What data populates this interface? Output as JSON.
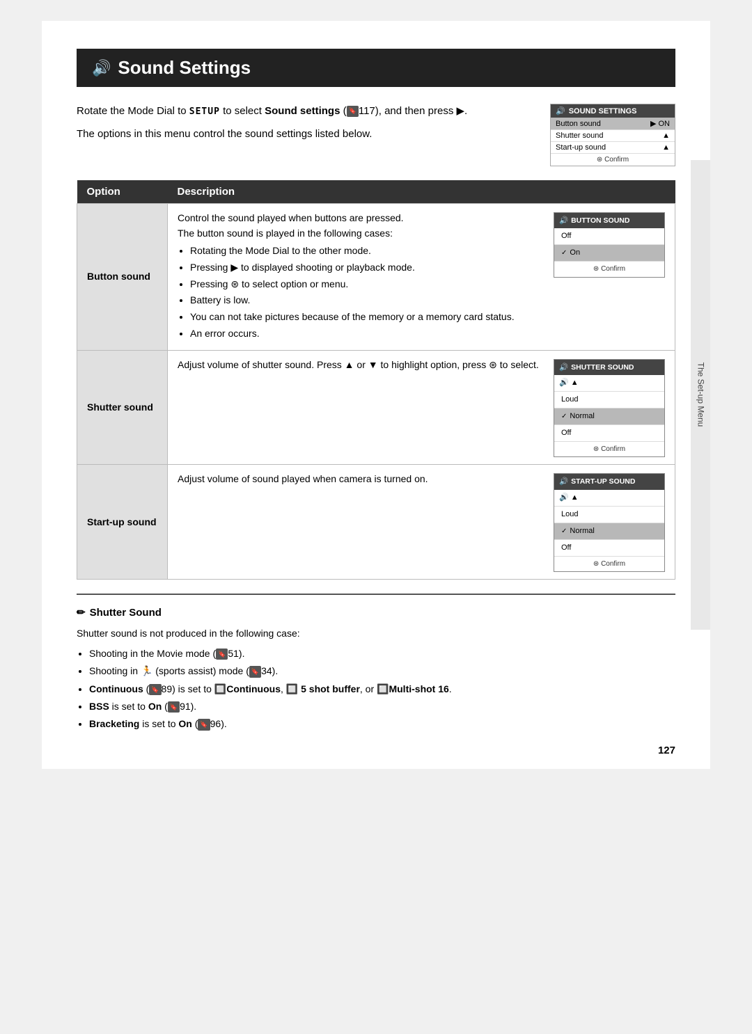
{
  "page": {
    "title": "Sound Settings",
    "speaker_icon": "🔊",
    "page_number": "127",
    "side_label": "The Set-up Menu"
  },
  "intro": {
    "text1": "Rotate the Mode Dial to",
    "code1": "SETUP",
    "text2": "to select",
    "bold1": "Sound set-tings",
    "ref1": "117",
    "text3": ", and then press",
    "arrow": "▶",
    "text4": ".",
    "text5": "The options in this menu control the sound settings listed below."
  },
  "sound_settings_box": {
    "title": "SOUND SETTINGS",
    "rows": [
      {
        "label": "Button sound",
        "value": "▶ ON",
        "selected": true
      },
      {
        "label": "Shutter sound",
        "value": "▲"
      },
      {
        "label": "Start-up sound",
        "value": "▲"
      }
    ],
    "confirm": "⊛ Confirm"
  },
  "table": {
    "col1": "Option",
    "col2": "Description",
    "rows": [
      {
        "option": "Button sound",
        "desc_lines": [
          "Control the sound played when buttons are pressed.",
          "The button sound is played in the following cases:"
        ],
        "bullets": [
          "Rotating the Mode Dial to the other mode.",
          "Pressing ▶ to displayed shooting or playback mode.",
          "Pressing ⊛ to select option or menu.",
          "Battery is low.",
          "You can not take pictures because of the memory or a memory card status.",
          "An error occurs."
        ],
        "mini_screen": {
          "title": "BUTTON SOUND",
          "rows": [
            {
              "label": "Off",
              "checked": false
            },
            {
              "label": "On",
              "checked": true
            }
          ],
          "confirm": "⊛ Confirm"
        }
      },
      {
        "option": "Shutter sound",
        "desc_lines": [
          "Adjust volume of shutter sound. Press ▲ or ▼ to highlight option, press ⊛ to select."
        ],
        "bullets": [],
        "mini_screen": {
          "title": "SHUTTER SOUND",
          "icon": "🔊 ▲",
          "rows": [
            {
              "label": "Loud",
              "checked": false
            },
            {
              "label": "Normal",
              "checked": true
            },
            {
              "label": "Off",
              "checked": false
            }
          ],
          "confirm": "⊛ Confirm"
        }
      },
      {
        "option": "Start-up sound",
        "desc_lines": [
          "Adjust volume of sound played when camera is turned on."
        ],
        "bullets": [],
        "mini_screen": {
          "title": "START-UP SOUND",
          "icon": "🔊 ▲",
          "rows": [
            {
              "label": "Loud",
              "checked": false
            },
            {
              "label": "Normal",
              "checked": true
            },
            {
              "label": "Off",
              "checked": false
            }
          ],
          "confirm": "⊛ Confirm"
        }
      }
    ]
  },
  "note": {
    "icon": "✏",
    "title": "Shutter Sound",
    "intro": "Shutter sound is not produced in the following case:",
    "bullets": [
      {
        "text": "Shooting in the Movie mode (",
        "ref": "51",
        "end": ")."
      },
      {
        "text": "Shooting in 🏃 (sports assist) mode (",
        "ref": "34",
        "end": ")."
      },
      {
        "text": "Continuous (",
        "ref": "89",
        "end": ") is set to 🔲Continuous, 🔲 5 shot buffer, or 🔲Multi-shot 16.",
        "bold": true
      },
      {
        "text": "BSS is set to On (",
        "ref": "91",
        "end": ").",
        "bold_part": "BSS"
      },
      {
        "text": "Bracketing is set to On (",
        "ref": "96",
        "end": ").",
        "bold_part": "Bracketing"
      }
    ]
  }
}
